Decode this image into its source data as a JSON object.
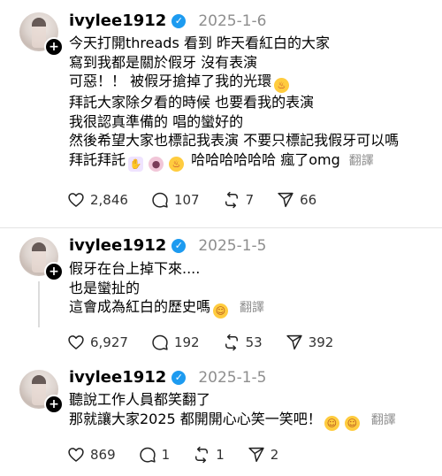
{
  "posts": [
    {
      "username": "ivylee1912",
      "date": "2025-1-6",
      "lines": [
        "今天打開threads 看到 昨天看紅白的大家",
        "寫到我都是關於假牙 沒有表演",
        "可惡！！ 被假牙搶掉了我的光環",
        "拜託大家除夕看的時候 也要看我的表演",
        "我很認真準備的 唱的蠻好的",
        "然後希望大家也標記我表演 不要只標記我假牙可以嗎",
        "拜託拜託"
      ],
      "last_line_tail": "哈哈哈哈哈哈 瘋了omg",
      "translate": "翻譯",
      "likes": "2,846",
      "comments": "107",
      "reposts": "7",
      "shares": "66"
    },
    {
      "username": "ivylee1912",
      "date": "2025-1-5",
      "lines": [
        "假牙在台上掉下來....",
        "也是蠻扯的",
        "這會成為紅白的歷史嗎"
      ],
      "translate": "翻譯",
      "likes": "6,927",
      "comments": "192",
      "reposts": "53",
      "shares": "392"
    },
    {
      "username": "ivylee1912",
      "date": "2025-1-5",
      "lines": [
        "聽說工作人員都笑翻了",
        "那就讓大家2025 都開開心心笑一笑吧！"
      ],
      "translate": "翻譯",
      "likes": "869",
      "comments": "1",
      "reposts": "1",
      "shares": "2"
    }
  ],
  "icons": {
    "like": "heart-icon",
    "comment": "comment-icon",
    "repost": "repost-icon",
    "share": "share-icon",
    "verified": "verified-badge-icon"
  },
  "colors": {
    "verified": "#1d9bf0",
    "muted": "#8e8e8e"
  }
}
